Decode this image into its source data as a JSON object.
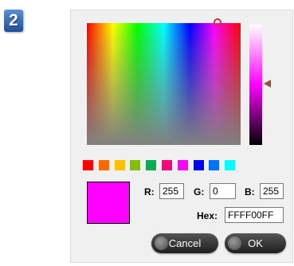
{
  "step": {
    "number": "2"
  },
  "picker": {
    "swatches": [
      "#ff0000",
      "#ff6a00",
      "#ffc000",
      "#80c000",
      "#00b050",
      "#ff0080",
      "#ff00ff",
      "#0000ff",
      "#0070ff",
      "#00ffff"
    ],
    "preview_color": "#ff00ff",
    "r_label": "R:",
    "r_value": "255",
    "g_label": "G:",
    "g_value": "0",
    "b_label": "B:",
    "b_value": "255",
    "hex_label": "Hex:",
    "hex_value": "FFFF00FF"
  },
  "buttons": {
    "cancel": "Cancel",
    "ok": "OK"
  },
  "colors": {
    "marker": "#c0392b",
    "slider_arrow": "#a0522d",
    "button_bg": "#2b2b2b"
  }
}
